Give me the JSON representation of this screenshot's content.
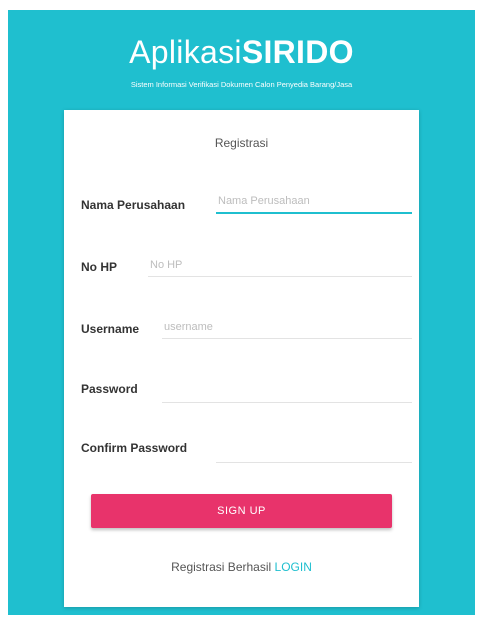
{
  "header": {
    "title_light": "Aplikasi",
    "title_bold": "SIRIDO",
    "subtitle": "Sistem Informasi Verifikasi Dokumen Calon Penyedia Barang/Jasa"
  },
  "form": {
    "title": "Registrasi",
    "fields": {
      "company": {
        "label": "Nama Perusahaan",
        "placeholder": "Nama Perusahaan",
        "value": ""
      },
      "phone": {
        "label": "No HP",
        "placeholder": "No HP",
        "value": ""
      },
      "username": {
        "label": "Username",
        "placeholder": "username",
        "value": ""
      },
      "password": {
        "label": "Password",
        "placeholder": "",
        "value": ""
      },
      "confirm_password": {
        "label": "Confirm Password",
        "placeholder": "",
        "value": ""
      }
    },
    "submit_label": "SIGN UP",
    "footer_text": "Registrasi Berhasil",
    "login_link": "LOGIN"
  },
  "colors": {
    "background": "#1fbfcf",
    "button": "#e8336b",
    "link": "#1fbfcf"
  }
}
